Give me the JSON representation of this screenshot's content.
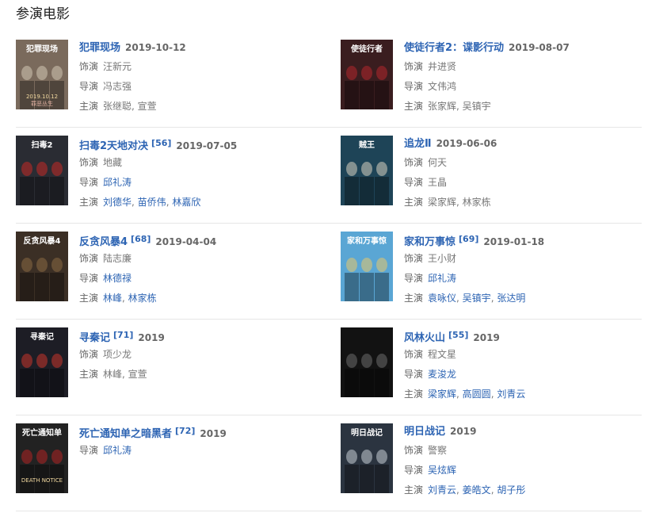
{
  "section": {
    "title": "参演电影"
  },
  "labels": {
    "role": "饰演",
    "director": "导演",
    "cast": "主演"
  },
  "movies": [
    {
      "title": "犯罪现场",
      "ref": "",
      "date": "2019-10-12",
      "poster": {
        "bg": "#7a6a5c",
        "accent": "#d2c6b4",
        "text": "犯罪现场",
        "sub": "2019.10.12",
        "sub2": "罪恶丛生"
      },
      "role": "汪新元",
      "director": [
        {
          "name": "冯志强",
          "link": false
        }
      ],
      "cast": [
        {
          "name": "张继聪",
          "link": false
        },
        {
          "name": "宣萱",
          "link": false
        }
      ]
    },
    {
      "title": "使徒行者2：谍影行动",
      "ref": "",
      "date": "2019-08-07",
      "poster": {
        "bg": "#3a1d1f",
        "accent": "#b3262b",
        "text": "使徒行者",
        "sub": "",
        "sub2": ""
      },
      "role": "井进贤",
      "director": [
        {
          "name": "文伟鸿",
          "link": false
        }
      ],
      "cast": [
        {
          "name": "张家辉",
          "link": false
        },
        {
          "name": "吴镇宇",
          "link": false
        }
      ]
    },
    {
      "title": "扫毒2天地对决",
      "ref": "[56]",
      "date": "2019-07-05",
      "poster": {
        "bg": "#2a2c33",
        "accent": "#c52a24",
        "text": "扫毒2",
        "sub": "",
        "sub2": ""
      },
      "role": "地藏",
      "director": [
        {
          "name": "邱礼涛",
          "link": true
        }
      ],
      "cast": [
        {
          "name": "刘德华",
          "link": true
        },
        {
          "name": "苗侨伟",
          "link": true
        },
        {
          "name": "林嘉欣",
          "link": true
        }
      ]
    },
    {
      "title": "追龙Ⅱ",
      "ref": "",
      "date": "2019-06-06",
      "poster": {
        "bg": "#1e4457",
        "accent": "#d8d2c0",
        "text": "贼王",
        "sub": "",
        "sub2": ""
      },
      "role": "何天",
      "director": [
        {
          "name": "王晶",
          "link": false
        }
      ],
      "cast": [
        {
          "name": "梁家辉",
          "link": false
        },
        {
          "name": "林家栋",
          "link": false
        }
      ]
    },
    {
      "title": "反贪风暴4",
      "ref": "[68]",
      "date": "2019-04-04",
      "poster": {
        "bg": "#3b2f25",
        "accent": "#8b6a43",
        "text": "反贪风暴4",
        "sub": "",
        "sub2": ""
      },
      "role": "陆志廉",
      "director": [
        {
          "name": "林德禄",
          "link": true
        }
      ],
      "cast": [
        {
          "name": "林峰",
          "link": true
        },
        {
          "name": "林家栋",
          "link": true
        }
      ]
    },
    {
      "title": "家和万事惊",
      "ref": "[69]",
      "date": "2019-01-18",
      "poster": {
        "bg": "#5aa6d4",
        "accent": "#e8c66a",
        "text": "家和万事惊",
        "sub": "",
        "sub2": ""
      },
      "role": "王小财",
      "director": [
        {
          "name": "邱礼涛",
          "link": true
        }
      ],
      "cast": [
        {
          "name": "袁咏仪",
          "link": true
        },
        {
          "name": "吴镇宇",
          "link": true
        },
        {
          "name": "张达明",
          "link": true
        }
      ]
    },
    {
      "title": "寻秦记",
      "ref": "[71]",
      "date": "2019",
      "poster": {
        "bg": "#1d1d25",
        "accent": "#c8342c",
        "text": "寻秦记",
        "sub": "",
        "sub2": ""
      },
      "role": "项少龙",
      "director": [],
      "cast": [
        {
          "name": "林峰",
          "link": false
        },
        {
          "name": "宣萱",
          "link": false
        }
      ]
    },
    {
      "title": "风林火山",
      "ref": "[55]",
      "date": "2019",
      "poster": {
        "bg": "#121212",
        "accent": "#6b6b6b",
        "text": "",
        "sub": "",
        "sub2": ""
      },
      "role": "程文星",
      "director": [
        {
          "name": "麦浚龙",
          "link": true
        }
      ],
      "cast": [
        {
          "name": "梁家辉",
          "link": true
        },
        {
          "name": "高圆圆",
          "link": true
        },
        {
          "name": "刘青云",
          "link": true
        }
      ]
    },
    {
      "title": "死亡通知单之暗黑者",
      "ref": "[72]",
      "date": "2019",
      "poster": {
        "bg": "#222222",
        "accent": "#b02222",
        "text": "死亡通知单",
        "sub": "DEATH NOTICE",
        "sub2": ""
      },
      "role": "",
      "director": [
        {
          "name": "邱礼涛",
          "link": true
        }
      ],
      "cast": []
    },
    {
      "title": "明日战记",
      "ref": "",
      "date": "2019",
      "poster": {
        "bg": "#2b3440",
        "accent": "#c7cdd4",
        "text": "明日战记",
        "sub": "",
        "sub2": ""
      },
      "role": "警察",
      "director": [
        {
          "name": "吴炫辉",
          "link": true
        }
      ],
      "cast": [
        {
          "name": "刘青云",
          "link": true
        },
        {
          "name": "姜皓文",
          "link": true
        },
        {
          "name": "胡子彤",
          "link": true
        }
      ]
    }
  ]
}
